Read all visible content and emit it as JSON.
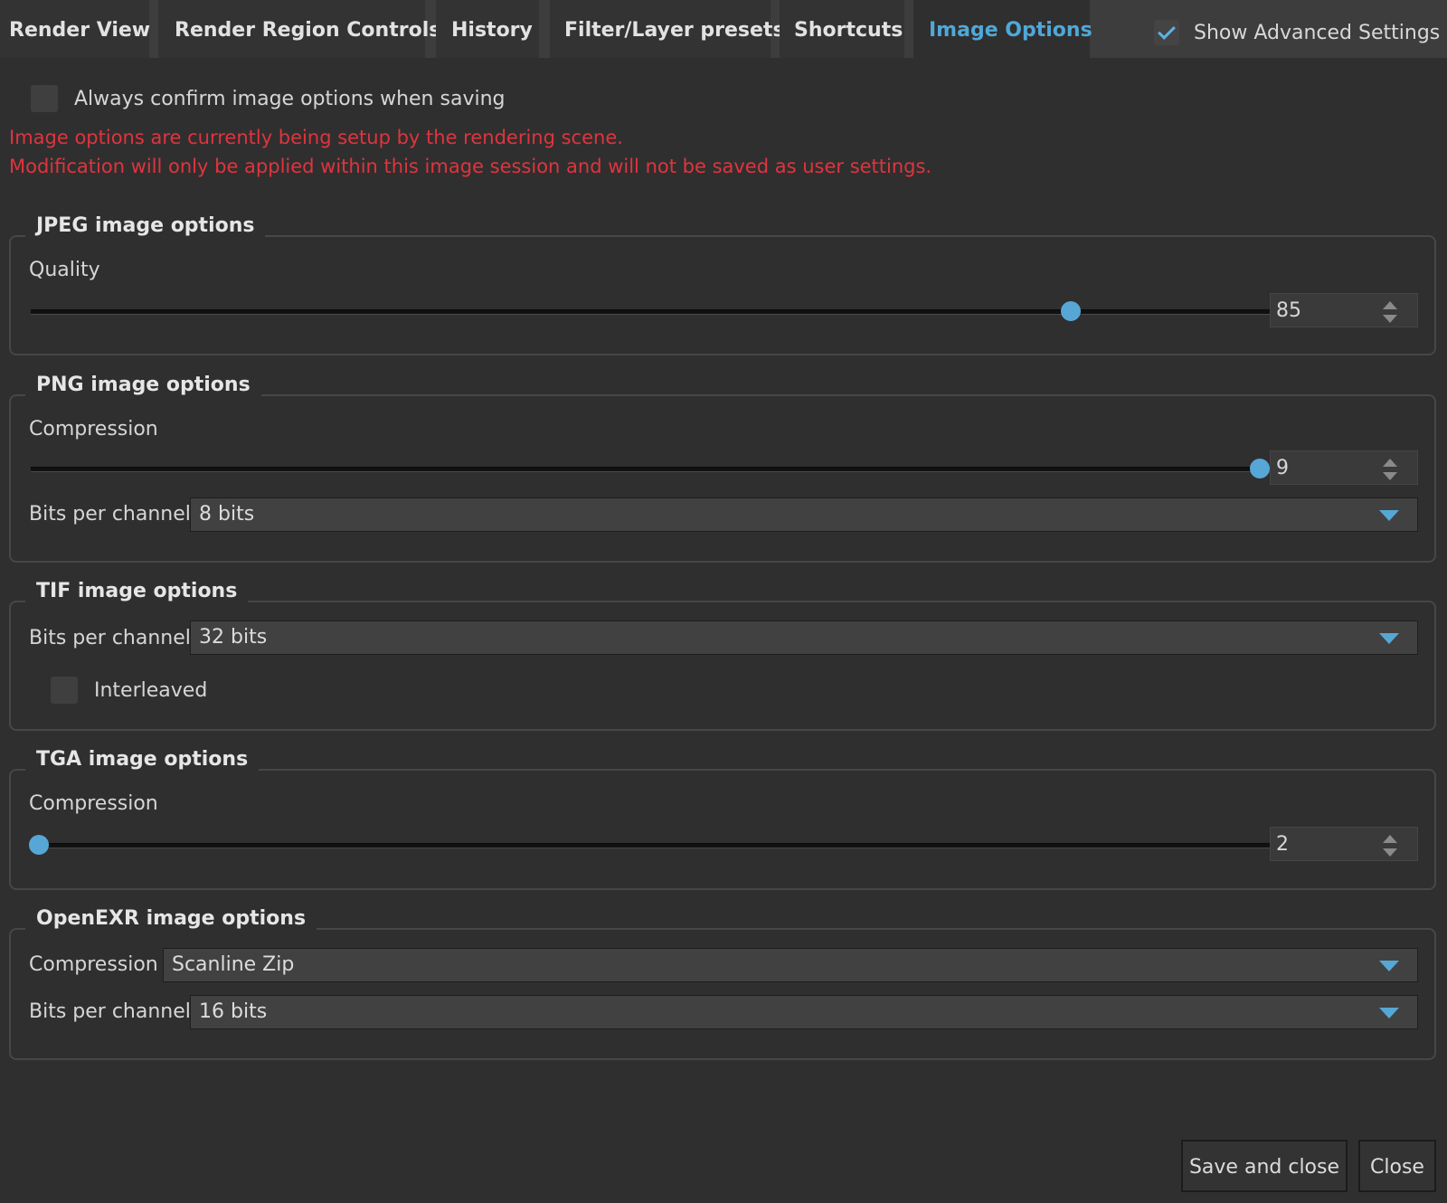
{
  "tabs": [
    {
      "label": "Render View",
      "active": false
    },
    {
      "label": "Render Region Controls",
      "active": false
    },
    {
      "label": "History",
      "active": false
    },
    {
      "label": "Filter/Layer presets",
      "active": false
    },
    {
      "label": "Shortcuts",
      "active": false
    },
    {
      "label": "Image Options",
      "active": true
    }
  ],
  "show_advanced": {
    "label": "Show Advanced Settings",
    "checked": true
  },
  "confirm_option": {
    "label": "Always confirm image options when saving",
    "checked": false
  },
  "warning": {
    "line1": "Image options are currently being setup by the rendering scene.",
    "line2": "Modification will only be applied within this image session and will not be saved as user settings.",
    "color": "#e0343e"
  },
  "jpeg": {
    "title": "JPEG image options",
    "quality_label": "Quality",
    "quality_value": "85",
    "quality_fraction": 0.845
  },
  "png": {
    "title": "PNG image options",
    "compression_label": "Compression",
    "compression_value": "9",
    "compression_fraction": 1.0,
    "bits_label": "Bits per channel",
    "bits_value": "8 bits"
  },
  "tif": {
    "title": "TIF image options",
    "bits_label": "Bits per channel",
    "bits_value": "32 bits",
    "interleaved_label": "Interleaved",
    "interleaved_checked": false
  },
  "tga": {
    "title": "TGA image options",
    "compression_label": "Compression",
    "compression_value": "2",
    "compression_fraction": 0.0
  },
  "exr": {
    "title": "OpenEXR image options",
    "compression_label": "Compression",
    "compression_value": "Scanline Zip",
    "bits_label": "Bits per channel",
    "bits_value": "16 bits"
  },
  "buttons": {
    "save_close": "Save and close",
    "close": "Close"
  },
  "colors": {
    "accent": "#57a7d6",
    "background": "#2f2f2f",
    "tab_bar": "#3d3d3d"
  }
}
